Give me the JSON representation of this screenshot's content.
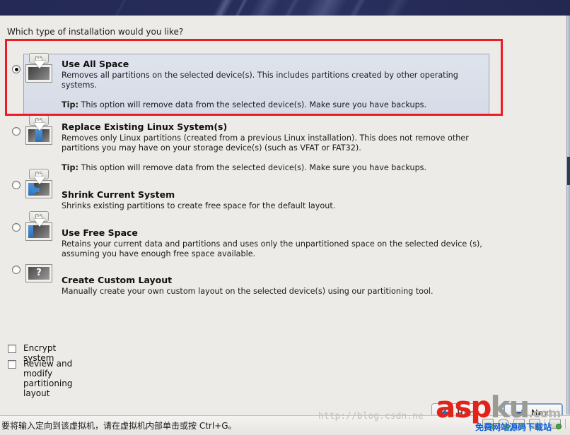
{
  "window": {
    "question": "Which type of installation would you like?"
  },
  "options": [
    {
      "id": "use-all-space",
      "title": "Use All Space",
      "description": "Removes all partitions on the selected device(s).  This includes partitions created by other operating systems.",
      "tip_label": "Tip:",
      "tip_text": "This option will remove data from the selected device(s).  Make sure you have backups.",
      "selected": true,
      "icon": "os-disk-erase-icon",
      "icon_tag": "OS"
    },
    {
      "id": "replace-existing-linux",
      "title": "Replace Existing Linux System(s)",
      "description": "Removes only Linux partitions (created from a previous Linux installation).  This does not remove other partitions you may have on your storage device(s) (such as VFAT or FAT32).",
      "tip_label": "Tip:",
      "tip_text": "This option will remove data from the selected device(s).  Make sure you have backups.",
      "selected": false,
      "icon": "os-disk-replace-icon",
      "icon_tag": "OS"
    },
    {
      "id": "shrink-current-system",
      "title": "Shrink Current System",
      "description": "Shrinks existing partitions to create free space for the default layout.",
      "tip_label": "",
      "tip_text": "",
      "selected": false,
      "icon": "os-disk-shrink-icon",
      "icon_tag": "OS"
    },
    {
      "id": "use-free-space",
      "title": "Use Free Space",
      "description": "Retains your current data and partitions and uses only the unpartitioned space on the selected device (s), assuming you have enough free space available.",
      "tip_label": "",
      "tip_text": "",
      "selected": false,
      "icon": "os-disk-free-space-icon",
      "icon_tag": "OS"
    },
    {
      "id": "create-custom-layout",
      "title": "Create Custom Layout",
      "description": "Manually create your own custom layout on the selected device(s) using our partitioning tool.",
      "tip_label": "",
      "tip_text": "",
      "selected": false,
      "icon": "os-disk-custom-icon",
      "icon_tag": "?"
    }
  ],
  "checkboxes": [
    {
      "id": "encrypt-system",
      "label": "Encrypt system",
      "checked": false
    },
    {
      "id": "review-modify-partitioning",
      "label": "Review and modify partitioning layout",
      "checked": false
    }
  ],
  "buttons": {
    "back": "Back",
    "next": "Next"
  },
  "statusbar": {
    "text": "要将输入定向到该虚拟机，请在虚拟机内部单击或按 Ctrl+G。"
  },
  "watermarks": {
    "asp_red": "asp",
    "asp_gray": "ku",
    "asp_com": ".com",
    "csdn": "http://blog.csdn.ne",
    "chinese": "免费网站源码下载站"
  },
  "colors": {
    "annotation_red": "#ed1c24",
    "banner_navy": "#242a55",
    "selected_panel": "#dfe3ec",
    "page_background": "#edebe7",
    "accent_blue": "#3d86ce"
  }
}
